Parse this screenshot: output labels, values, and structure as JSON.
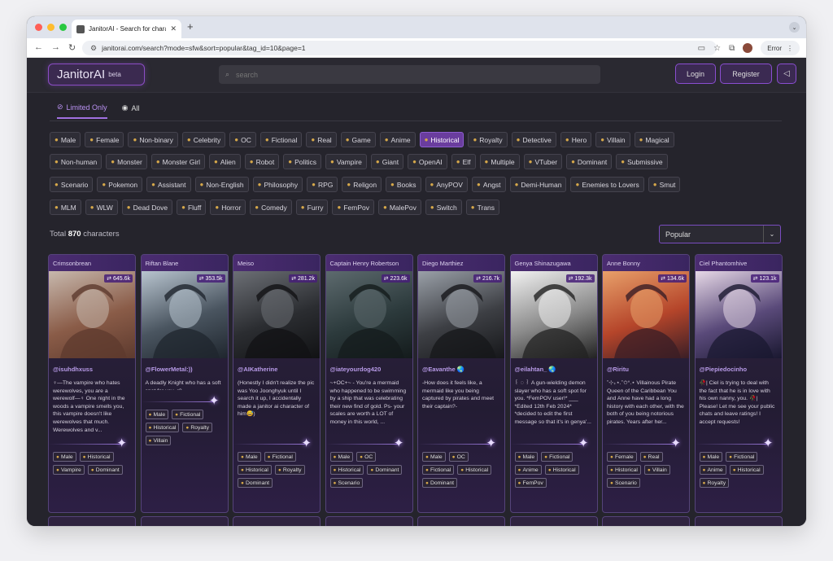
{
  "browser": {
    "tab_title": "JanitorAI - Search for charac",
    "url": "janitorai.com/search?mode=sfw&sort=popular&tag_id=10&page=1",
    "error_label": "Error"
  },
  "header": {
    "logo": "JanitorAI",
    "logo_badge": "beta",
    "search_placeholder": "search",
    "login": "Login",
    "register": "Register"
  },
  "modes": [
    {
      "label": "Limited Only",
      "icon": "eye-slash-icon",
      "active": true
    },
    {
      "label": "All",
      "icon": "eye-icon",
      "active": false
    }
  ],
  "tag_rows": [
    [
      "Male",
      "Female",
      "Non-binary",
      "Celebrity",
      "OC",
      "Fictional",
      "Real",
      "Game",
      "Anime",
      "Historical",
      "Royalty",
      "Detective",
      "Hero",
      "Villain",
      "Magical"
    ],
    [
      "Non-human",
      "Monster",
      "Monster Girl",
      "Alien",
      "Robot",
      "Politics",
      "Vampire",
      "Giant",
      "OpenAI",
      "Elf",
      "Multiple",
      "VTuber",
      "Dominant",
      "Submissive"
    ],
    [
      "Scenario",
      "Pokemon",
      "Assistant",
      "Non-English",
      "Philosophy",
      "RPG",
      "Religon",
      "Books",
      "AnyPOV",
      "Angst",
      "Demi-Human",
      "Enemies to Lovers",
      "Smut"
    ],
    [
      "MLM",
      "WLW",
      "Dead Dove",
      "Fluff",
      "Horror",
      "Comedy",
      "Furry",
      "FemPov",
      "MalePov",
      "Switch",
      "Trans"
    ]
  ],
  "selected_tag": "Historical",
  "total_prefix": "Total",
  "total_count": "870",
  "total_suffix": "characters",
  "sort": "Popular",
  "cards": [
    {
      "name": "Crimsonbrean",
      "count": "645.6k",
      "author": "@isuhdhxuss",
      "desc": "♀—The vampire who hates werewolves, you are a werewolf—♀ One night in the woods a vampire smells you, this vampire doesn't like werewolves that much. Werewolves and v...",
      "tags": [
        "Male",
        "Historical",
        "Vampire",
        "Dominant"
      ],
      "palette": [
        "#c7b8ad",
        "#8a5c48",
        "#5d3a2e"
      ]
    },
    {
      "name": "Riftan Blane",
      "count": "353.5k",
      "author": "@FlowerMetal:))",
      "desc": "A deadly Knight who has a soft spot for you.<3",
      "tags": [
        "Male",
        "Fictional",
        "Historical",
        "Royalty",
        "Villain"
      ],
      "palette": [
        "#b8c4cf",
        "#4a5560",
        "#1f262e"
      ]
    },
    {
      "name": "Meiso",
      "count": "281.2k",
      "author": "@AIKatherine",
      "desc": "(Honestly I didn't realize the pic was Yoo Joonghyuk until I search it up, I accidentally made a janitor ai character of him😅)",
      "tags": [
        "Male",
        "Fictional",
        "Historical",
        "Royalty",
        "Dominant"
      ],
      "palette": [
        "#6c6f75",
        "#2b2d31",
        "#111214"
      ]
    },
    {
      "name": "Captain Henry Robertson",
      "count": "223.6k",
      "author": "@iateyourdog420",
      "desc": "~+OC+~ - You're a mermaid who happened to be swimming by a ship that was celebrating their new find of gold. Ps- your scales are worth a LOT of money in this world, ...",
      "tags": [
        "Male",
        "OC",
        "Historical",
        "Dominant",
        "Scenario"
      ],
      "palette": [
        "#5d6a6e",
        "#2c3a3c",
        "#141b1c"
      ]
    },
    {
      "name": "Diego Marthiez",
      "count": "216.7k",
      "author": "@Eavanthe 🌏",
      "desc": "-How does it feels like, a mermaid like you being captured by pirates and meet their captain?-",
      "tags": [
        "Male",
        "OC",
        "Fictional",
        "Historical",
        "Dominant"
      ],
      "palette": [
        "#9aa0a8",
        "#3d3f44",
        "#16171a"
      ]
    },
    {
      "name": "Genya Shinazugawa",
      "count": "192.3k",
      "author": "@eilahtan_ 🌏",
      "desc": "꒰ ◌ ꒱ A gun-wielding demon slayer who has a soft spot for you. *FemPOV user!* ___ *Edited 12th Feb 2024* *decided to edit the first message so that it's in genya'...",
      "tags": [
        "Male",
        "Fictional",
        "Anime",
        "Historical",
        "FemPov"
      ],
      "palette": [
        "#f2f2f2",
        "#8a8a8a",
        "#222222"
      ]
    },
    {
      "name": "Anne Bonny",
      "count": "134.6k",
      "author": "@Riritu",
      "desc": "˚⊹₊⋆.˚✩°.⋆ Villainous Pirate Queen of the Caribbean You and Anne have had a long history with each other, with the both of you being notorious pirates. Years after her...",
      "tags": [
        "Female",
        "Real",
        "Historical",
        "Villain",
        "Scenario"
      ],
      "palette": [
        "#e8a06a",
        "#b5452a",
        "#3a1e26"
      ]
    },
    {
      "name": "Ciel Phantomhive",
      "count": "123.1k",
      "author": "@Piepiedocinho",
      "desc": "🥀| Ciel is trying to deal with the fact that he is in love with his own nanny, you. 🥀| Please! Let me see your public chats and leave ratings! I accept requests!",
      "tags": [
        "Male",
        "Fictional",
        "Anime",
        "Historical",
        "Royalty"
      ],
      "palette": [
        "#e6d8e6",
        "#5a4a7a",
        "#1a1830"
      ]
    }
  ]
}
